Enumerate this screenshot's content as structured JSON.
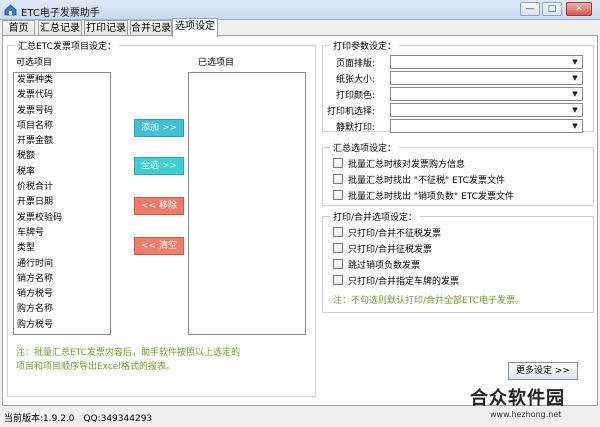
{
  "window": {
    "title": "ETC电子发票助手",
    "controls": {
      "minimize": "—",
      "maximize": "□",
      "close": "✕"
    }
  },
  "tabs": [
    {
      "label": "首页"
    },
    {
      "label": "汇总记录"
    },
    {
      "label": "打印记录"
    },
    {
      "label": "合并记录"
    },
    {
      "label": "选项设定"
    }
  ],
  "summary_items": {
    "group_title": "汇总ETC发票项目设定：",
    "available_label": "可选项目",
    "selected_label": "已选项目",
    "available": [
      "发票种类",
      "发票代码",
      "发票号码",
      "项目名称",
      "开票金额",
      "税额",
      "税率",
      "价税合计",
      "开票日期",
      "发票校验码",
      "车牌号",
      "类型",
      "通行时间",
      "销方名称",
      "销方税号",
      "购方名称",
      "购方税号"
    ],
    "buttons": {
      "add": "添加 >>",
      "select_all": "全选 >>",
      "remove": "<< 移除",
      "clear": "<< 清空"
    },
    "note_line1": "注：批量汇总ETC发票内容后，助手软件按照以上选定的",
    "note_line2": "项目和项目顺序导出Excel格式的报表。"
  },
  "print_params": {
    "group_title": "打印参数设定：",
    "rows": [
      {
        "label": "页面排版:",
        "value": ""
      },
      {
        "label": "纸张大小:",
        "value": ""
      },
      {
        "label": "打印颜色:",
        "value": ""
      },
      {
        "label": "打印机选择:",
        "value": ""
      },
      {
        "label": "静默打印:",
        "value": ""
      }
    ]
  },
  "summary_options": {
    "group_title": "汇总选项设定：",
    "items": [
      "批量汇总时核对发票购方信息",
      "批量汇总时找出 \"不征税\" ETC发票文件",
      "批量汇总时找出 \"销项负数\" ETC发票文件"
    ]
  },
  "print_merge_options": {
    "group_title": "打印/合并选项设定：",
    "items": [
      "只打印/合并不征税发票",
      "只打印/合并征税发票",
      "跳过销项负数发票",
      "只打印/合并指定车牌的发票"
    ],
    "note": "注：不勾选则默认打印/合并全部ETC电子发票。"
  },
  "more_settings": "更多设定 >>",
  "status": {
    "version": "当前版本:1.9.2.0",
    "qq": "QQ:349344293"
  },
  "watermark": {
    "text": "合众软件园",
    "url": "www.hezhong.net"
  },
  "colors": {
    "green_note": "#6aa02a",
    "add": "#3fc0d6",
    "remove": "#f07a6a"
  }
}
